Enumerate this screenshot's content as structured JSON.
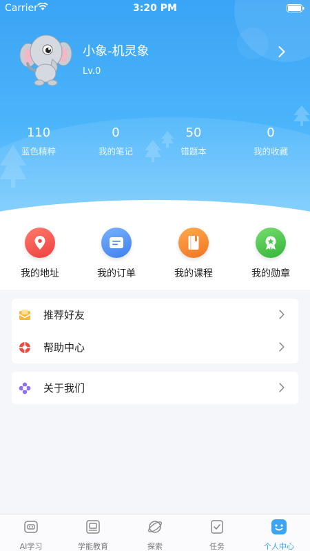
{
  "status_bar": {
    "carrier": "Carrier",
    "time": "3:20 PM"
  },
  "profile": {
    "name": "小象-机灵象",
    "level": "Lv.0"
  },
  "stats": [
    {
      "value": "110",
      "label": "蓝色精粹"
    },
    {
      "value": "0",
      "label": "我的笔记"
    },
    {
      "value": "50",
      "label": "错题本"
    },
    {
      "value": "0",
      "label": "我的收藏"
    }
  ],
  "shortcuts": [
    {
      "label": "我的地址",
      "icon": "location-pin-icon",
      "color": "#f4534f"
    },
    {
      "label": "我的订单",
      "icon": "order-icon",
      "color": "#4c8ef5"
    },
    {
      "label": "我的课程",
      "icon": "course-book-icon",
      "color": "#f6882c"
    },
    {
      "label": "我的勋章",
      "icon": "medal-icon",
      "color": "#49c94d"
    }
  ],
  "menu": {
    "group1": [
      {
        "label": "推荐好友",
        "icon": "envelope-icon"
      },
      {
        "label": "帮助中心",
        "icon": "lifebuoy-icon"
      }
    ],
    "group2": [
      {
        "label": "关于我们",
        "icon": "flower-icon"
      }
    ]
  },
  "tabbar": [
    {
      "label": "AI学习",
      "icon": "robot-icon",
      "active": false
    },
    {
      "label": "学能教育",
      "icon": "laptop-icon",
      "active": false
    },
    {
      "label": "探索",
      "icon": "planet-icon",
      "active": false
    },
    {
      "label": "任务",
      "icon": "task-check-icon",
      "active": false
    },
    {
      "label": "个人中心",
      "icon": "smiley-face-icon",
      "active": true
    }
  ],
  "colors": {
    "accent": "#3aa4f5",
    "header_top": "#3aa4f5",
    "header_bottom": "#7dcdfd"
  }
}
